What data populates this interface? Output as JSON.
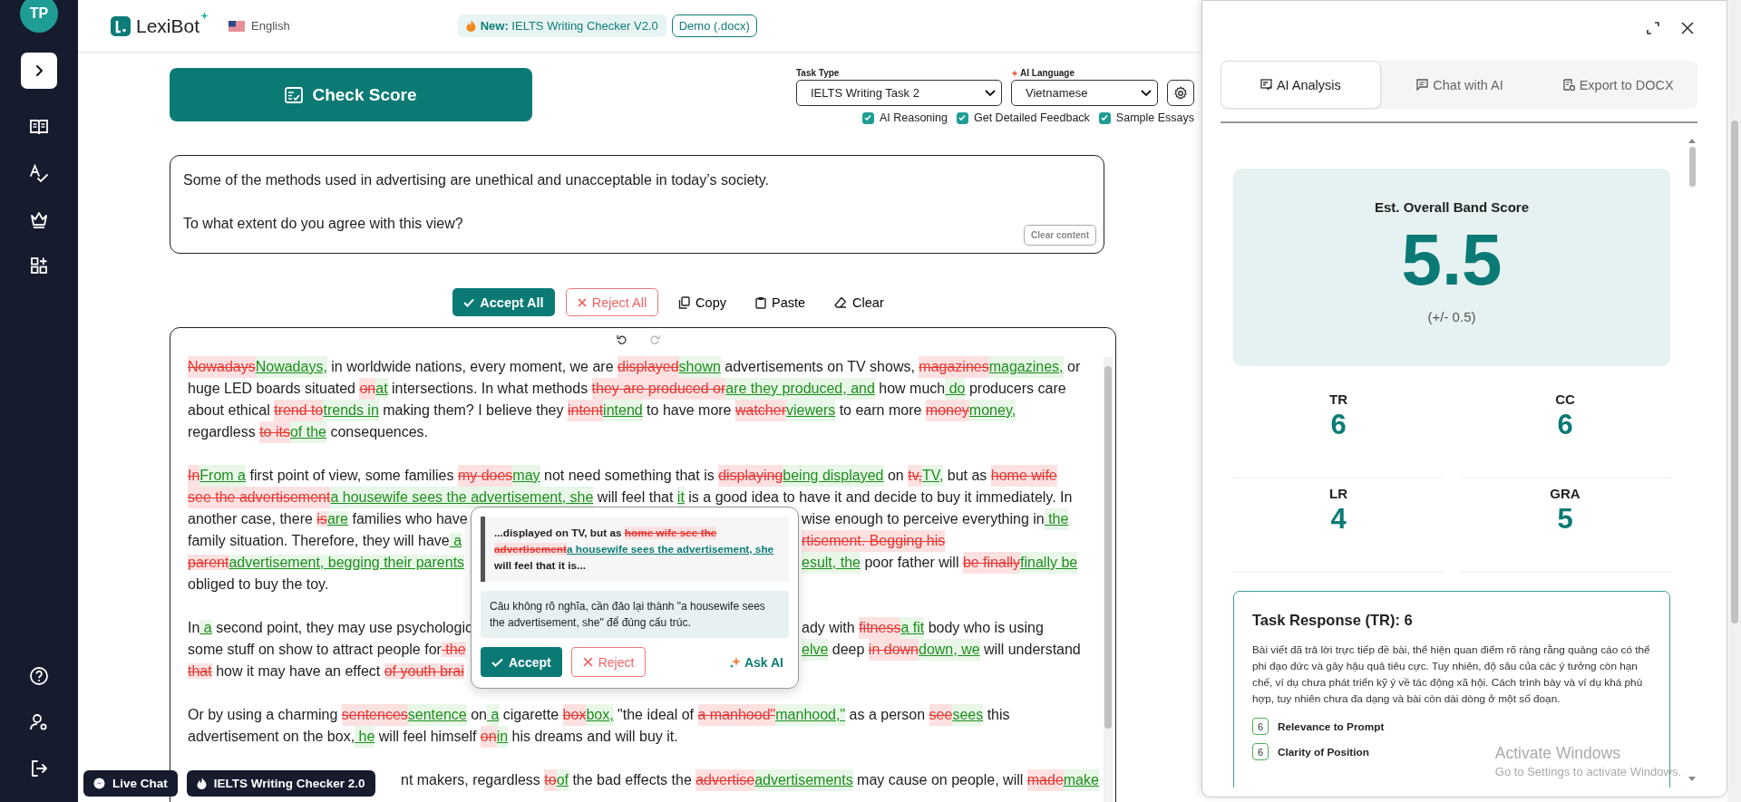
{
  "sidebar": {
    "avatar": "TP"
  },
  "header": {
    "logo": "LexiBot",
    "language": "English",
    "promo_label": "New:",
    "promo_text": "IELTS Writing Checker V2.0",
    "demo": "Demo (.docx)"
  },
  "controls": {
    "check_score": "Check Score",
    "task_type": {
      "label": "Task Type",
      "value": "IELTS Writing Task 2"
    },
    "ai_language": {
      "label": "AI Language",
      "value": "Vietnamese"
    },
    "options": [
      {
        "label": "AI Reasoning",
        "checked": true
      },
      {
        "label": "Get Detailed Feedback",
        "checked": true
      },
      {
        "label": "Sample Essays",
        "checked": true
      }
    ]
  },
  "prompt": {
    "lines": [
      "Some of the methods used in advertising are unethical and unacceptable in today’s society.",
      "To what extent do you agree with this view?"
    ],
    "clear": "Clear content"
  },
  "actions": [
    {
      "kind": "accept",
      "label": "Accept All"
    },
    {
      "kind": "reject",
      "label": "Reject All"
    },
    {
      "kind": "copy",
      "label": "Copy"
    },
    {
      "kind": "paste",
      "label": "Paste"
    },
    {
      "kind": "clear",
      "label": "Clear"
    }
  ],
  "editor": {
    "paragraphs": [
      {
        "lines": [
          [
            {
              "kind": "del",
              "text": "Nowadays"
            },
            {
              "kind": "ins",
              "text": "Nowadays,"
            },
            {
              "kind": "plain",
              "text": " in worldwide nations, every moment, we are "
            },
            {
              "kind": "del",
              "text": "displayed"
            },
            {
              "kind": "ins",
              "text": "shown"
            },
            {
              "kind": "plain",
              "text": " advertisements on TV shows, "
            },
            {
              "kind": "del",
              "text": "magazines"
            },
            {
              "kind": "ins",
              "text": "magazines,"
            },
            {
              "kind": "plain",
              "text": " or"
            }
          ],
          [
            {
              "kind": "plain",
              "text": "huge LED boards situated "
            },
            {
              "kind": "del",
              "text": "on"
            },
            {
              "kind": "ins",
              "text": "at"
            },
            {
              "kind": "plain",
              "text": " intersections. In what methods "
            },
            {
              "kind": "del",
              "text": "they are produced or"
            },
            {
              "kind": "ins",
              "text": "are they produced, and"
            },
            {
              "kind": "plain",
              "text": " how much"
            },
            {
              "kind": "ins",
              "text": " do"
            },
            {
              "kind": "plain",
              "text": " producers care"
            }
          ],
          [
            {
              "kind": "plain",
              "text": "about ethical "
            },
            {
              "kind": "del",
              "text": "trend to"
            },
            {
              "kind": "ins",
              "text": "trends in"
            },
            {
              "kind": "plain",
              "text": " making them? I believe they "
            },
            {
              "kind": "del",
              "text": "intent"
            },
            {
              "kind": "ins",
              "text": "intend"
            },
            {
              "kind": "plain",
              "text": " to have more "
            },
            {
              "kind": "del",
              "text": "watcher"
            },
            {
              "kind": "ins",
              "text": "viewers"
            },
            {
              "kind": "plain",
              "text": " to earn more "
            },
            {
              "kind": "del",
              "text": "money"
            },
            {
              "kind": "ins",
              "text": "money,"
            }
          ],
          [
            {
              "kind": "plain",
              "text": "regardless "
            },
            {
              "kind": "del",
              "text": "to its"
            },
            {
              "kind": "ins",
              "text": "of the"
            },
            {
              "kind": "plain",
              "text": " consequences."
            }
          ]
        ]
      },
      {
        "lines": [
          [
            {
              "kind": "del",
              "text": "In"
            },
            {
              "kind": "ins",
              "text": "From a"
            },
            {
              "kind": "plain",
              "text": " first point of view, some families "
            },
            {
              "kind": "del",
              "text": "my does"
            },
            {
              "kind": "ins",
              "text": "may"
            },
            {
              "kind": "plain",
              "text": " not need something that is "
            },
            {
              "kind": "del",
              "text": "displaying"
            },
            {
              "kind": "ins",
              "text": "being displayed"
            },
            {
              "kind": "plain",
              "text": " on "
            },
            {
              "kind": "del",
              "text": "tv,"
            },
            {
              "kind": "ins",
              "text": "TV,"
            },
            {
              "kind": "plain",
              "text": " but as "
            },
            {
              "kind": "del",
              "text": "home wife"
            }
          ],
          [
            {
              "kind": "del",
              "text": "see the advertisement"
            },
            {
              "kind": "ins",
              "text": "a housewife sees the advertisement, she"
            },
            {
              "kind": "plain",
              "text": " will feel that "
            },
            {
              "kind": "ins",
              "text": "it"
            },
            {
              "kind": "plain",
              "text": " is a good idea to have it and decide to buy it immediately. In"
            }
          ],
          [
            {
              "kind": "plain",
              "text": "another case, there "
            },
            {
              "kind": "del",
              "text": "is"
            },
            {
              "kind": "ins",
              "text": "are"
            },
            {
              "kind": "plain",
              "text": " families who have"
            },
            {
              "kind": "gap"
            },
            {
              "kind": "plain",
              "text": "wise enough to perceive everything in"
            },
            {
              "kind": "ins",
              "text": " the"
            }
          ],
          [
            {
              "kind": "plain",
              "text": "family situation. Therefore, they will have"
            },
            {
              "kind": "ins",
              "text": " a"
            },
            {
              "kind": "gap"
            },
            {
              "kind": "del",
              "text": "rtisement. Begging his"
            }
          ],
          [
            {
              "kind": "del",
              "text": "parent"
            },
            {
              "kind": "ins",
              "text": "advertisement, begging their parents"
            },
            {
              "kind": "gap"
            },
            {
              "kind": "ins",
              "text": "esult, the"
            },
            {
              "kind": "plain",
              "text": " poor father will "
            },
            {
              "kind": "del",
              "text": "be finally"
            },
            {
              "kind": "ins",
              "text": "finally be"
            }
          ],
          [
            {
              "kind": "plain",
              "text": "obliged to buy the toy."
            }
          ]
        ]
      },
      {
        "lines": [
          [
            {
              "kind": "plain",
              "text": "In"
            },
            {
              "kind": "ins",
              "text": " a"
            },
            {
              "kind": "plain",
              "text": " second point, they may use psychologic"
            },
            {
              "kind": "gap"
            },
            {
              "kind": "plain",
              "text": "ady with "
            },
            {
              "kind": "del",
              "text": "fitness"
            },
            {
              "kind": "ins",
              "text": "a fit"
            },
            {
              "kind": "plain",
              "text": " body who is using"
            }
          ],
          [
            {
              "kind": "plain",
              "text": "some stuff on show to attract people for"
            },
            {
              "kind": "del",
              "text": " the"
            },
            {
              "kind": "gap"
            },
            {
              "kind": "ins",
              "text": "elve"
            },
            {
              "kind": "plain",
              "text": " deep "
            },
            {
              "kind": "del",
              "text": "in down"
            },
            {
              "kind": "ins",
              "text": "down, we"
            },
            {
              "kind": "plain",
              "text": " will understand"
            }
          ],
          [
            {
              "kind": "del",
              "text": "that"
            },
            {
              "kind": "plain",
              "text": " how it may have an effect "
            },
            {
              "kind": "del",
              "text": "of youth brai"
            },
            {
              "kind": "gap"
            }
          ]
        ]
      },
      {
        "lines": [
          [
            {
              "kind": "plain",
              "text": "Or by using a charming "
            },
            {
              "kind": "del",
              "text": "sentences"
            },
            {
              "kind": "ins",
              "text": "sentence"
            },
            {
              "kind": "plain",
              "text": " on"
            },
            {
              "kind": "ins",
              "text": " a"
            },
            {
              "kind": "plain",
              "text": " cigarette "
            },
            {
              "kind": "del",
              "text": "box"
            },
            {
              "kind": "ins",
              "text": "box,"
            },
            {
              "kind": "plain",
              "text": " \"the ideal of "
            },
            {
              "kind": "del",
              "text": "a manhood\""
            },
            {
              "kind": "ins",
              "text": "manhood,\""
            },
            {
              "kind": "plain",
              "text": " as a person "
            },
            {
              "kind": "del",
              "text": "see"
            },
            {
              "kind": "ins",
              "text": "sees"
            },
            {
              "kind": "plain",
              "text": " this"
            }
          ],
          [
            {
              "kind": "plain",
              "text": "advertisement on the box,"
            },
            {
              "kind": "ins",
              "text": " he"
            },
            {
              "kind": "plain",
              "text": " will feel himself "
            },
            {
              "kind": "del",
              "text": "on"
            },
            {
              "kind": "ins",
              "text": "in"
            },
            {
              "kind": "plain",
              "text": " his dreams and will buy it."
            }
          ]
        ]
      },
      {
        "lines": [
          [
            {
              "kind": "gap"
            },
            {
              "kind": "plain",
              "text": "nt makers, regardless "
            },
            {
              "kind": "del",
              "text": "to"
            },
            {
              "kind": "ins",
              "text": "of"
            },
            {
              "kind": "plain",
              "text": " the bad effects the "
            },
            {
              "kind": "del",
              "text": "advertise"
            },
            {
              "kind": "ins",
              "text": "advertisements"
            },
            {
              "kind": "plain",
              "text": " may cause on people, will "
            },
            {
              "kind": "del",
              "text": "made"
            },
            {
              "kind": "ins",
              "text": "make"
            }
          ]
        ]
      }
    ]
  },
  "popup": {
    "context": [
      {
        "kind": "plain",
        "text": "...displayed on TV, but as "
      },
      {
        "kind": "del",
        "text": "home wife see the advertisement"
      },
      {
        "kind": "ins",
        "text": "a housewife sees the advertisement, she"
      },
      {
        "kind": "plain",
        "text": " will feel that it is..."
      }
    ],
    "explanation": "Câu không rõ nghĩa, cần đảo lại thành \"a housewife sees the advertisement, she\" để đúng cấu trúc.",
    "accept": "Accept",
    "reject": "Reject",
    "ask": "Ask AI"
  },
  "floating": [
    {
      "kind": "chat",
      "label": "Live Chat"
    },
    {
      "kind": "app",
      "label": "IELTS Writing Checker 2.0"
    }
  ],
  "panel": {
    "tabs": [
      {
        "kind": "analysis",
        "label": "AI Analysis",
        "selected": true
      },
      {
        "kind": "chat",
        "label": "Chat with AI",
        "selected": false
      },
      {
        "kind": "export",
        "label": "Export to DOCX",
        "selected": false
      }
    ],
    "score": {
      "title": "Est. Overall Band Score",
      "value": "5.5",
      "range": "(+/- 0.5)"
    },
    "criteria": [
      {
        "code": "TR",
        "score": "6"
      },
      {
        "code": "CC",
        "score": "6"
      },
      {
        "code": "LR",
        "score": "4"
      },
      {
        "code": "GRA",
        "score": "5"
      }
    ],
    "detail": {
      "title": "Task Response (TR): 6",
      "text": "Bài viết đã trả lời trực tiếp đề bài, thể hiện quan điểm rõ ràng rằng quảng cáo có thể phi đạo đức và gây hậu quả tiêu cực. Tuy nhiên, độ sâu của các ý tưởng còn hạn chế, ví dụ chưa phát triển kỹ ý về tác động xã hội. Cách trình bày và ví dụ khá phù hợp, tuy nhiên chưa đa dạng và bài còn dài dòng ở một số đoạn.",
      "items": [
        {
          "score": "6",
          "label": "Relevance to Prompt"
        },
        {
          "score": "6",
          "label": "Clarity of Position"
        }
      ]
    }
  },
  "os_watermark": {
    "title": "Activate Windows",
    "text": "Go to Settings to activate Windows."
  }
}
